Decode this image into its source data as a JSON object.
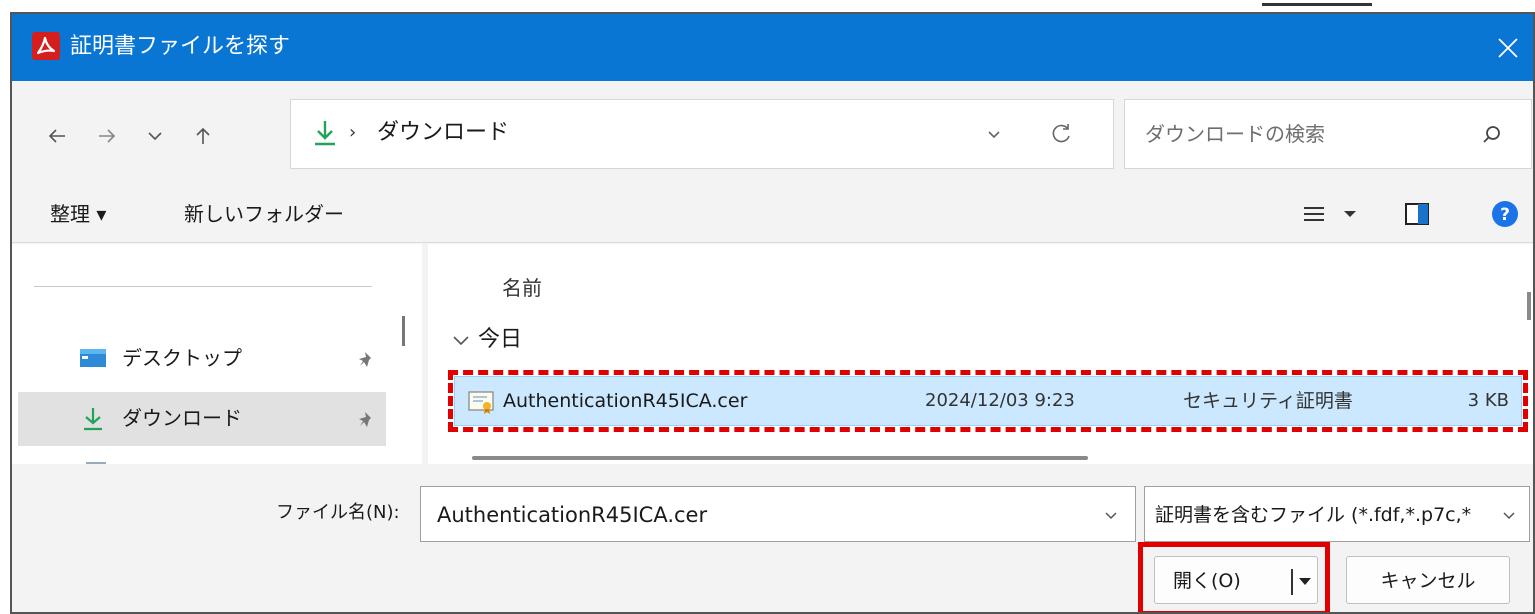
{
  "dialog": {
    "title": "証明書ファイルを探す",
    "close_icon": "close-icon"
  },
  "nav": {
    "back_icon": "back-arrow-icon",
    "forward_icon": "forward-arrow-icon",
    "recent_icon": "chevron-down-icon",
    "up_icon": "up-arrow-icon"
  },
  "address": {
    "location": "ダウンロード",
    "separator": "›"
  },
  "search": {
    "placeholder": "ダウンロードの検索"
  },
  "toolbar": {
    "organize_label": "整理 ▾",
    "new_folder_label": "新しいフォルダー"
  },
  "sidebar": {
    "items": [
      {
        "label": "デスクトップ",
        "icon": "desktop-icon"
      },
      {
        "label": "ダウンロード",
        "icon": "download-icon"
      }
    ]
  },
  "file_list": {
    "column_name": "名前",
    "group_label": "今日",
    "files": [
      {
        "name": "AuthenticationR45ICA.cer",
        "date": "2024/12/03 9:23",
        "type": "セキュリティ証明書",
        "size": "3 KB"
      }
    ]
  },
  "footer": {
    "filename_label": "ファイル名(N):",
    "filename_value": "AuthenticationR45ICA.cer",
    "filetype_value": "証明書を含むファイル (*.fdf,*.p7c,*",
    "open_label": "開く(O)",
    "cancel_label": "キャンセル"
  },
  "colors": {
    "titlebar": "#0a76d4",
    "selection": "#cce8ff",
    "highlight": "#e00000"
  }
}
